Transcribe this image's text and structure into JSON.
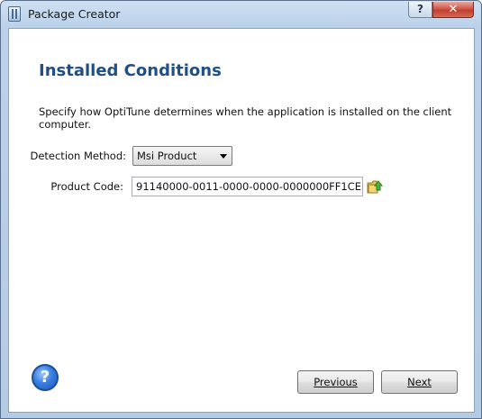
{
  "window": {
    "title": "Package Creator",
    "help_glyph": "?",
    "close_glyph": "✕"
  },
  "page": {
    "title": "Installed Conditions",
    "description": "Specify how OptiTune determines when the application is installed on the client computer."
  },
  "form": {
    "detection_method_label": "Detection Method:",
    "detection_method_value": "Msi Product",
    "product_code_label": "Product Code:",
    "product_code_value": "91140000-0011-0000-0000-0000000FF1CE"
  },
  "footer": {
    "help_glyph": "?",
    "previous_label": "Previous",
    "next_label": "Next"
  },
  "icons": {
    "app": "package-app-icon",
    "browse": "browse-folder-arrow-icon",
    "help": "help-question-icon"
  }
}
